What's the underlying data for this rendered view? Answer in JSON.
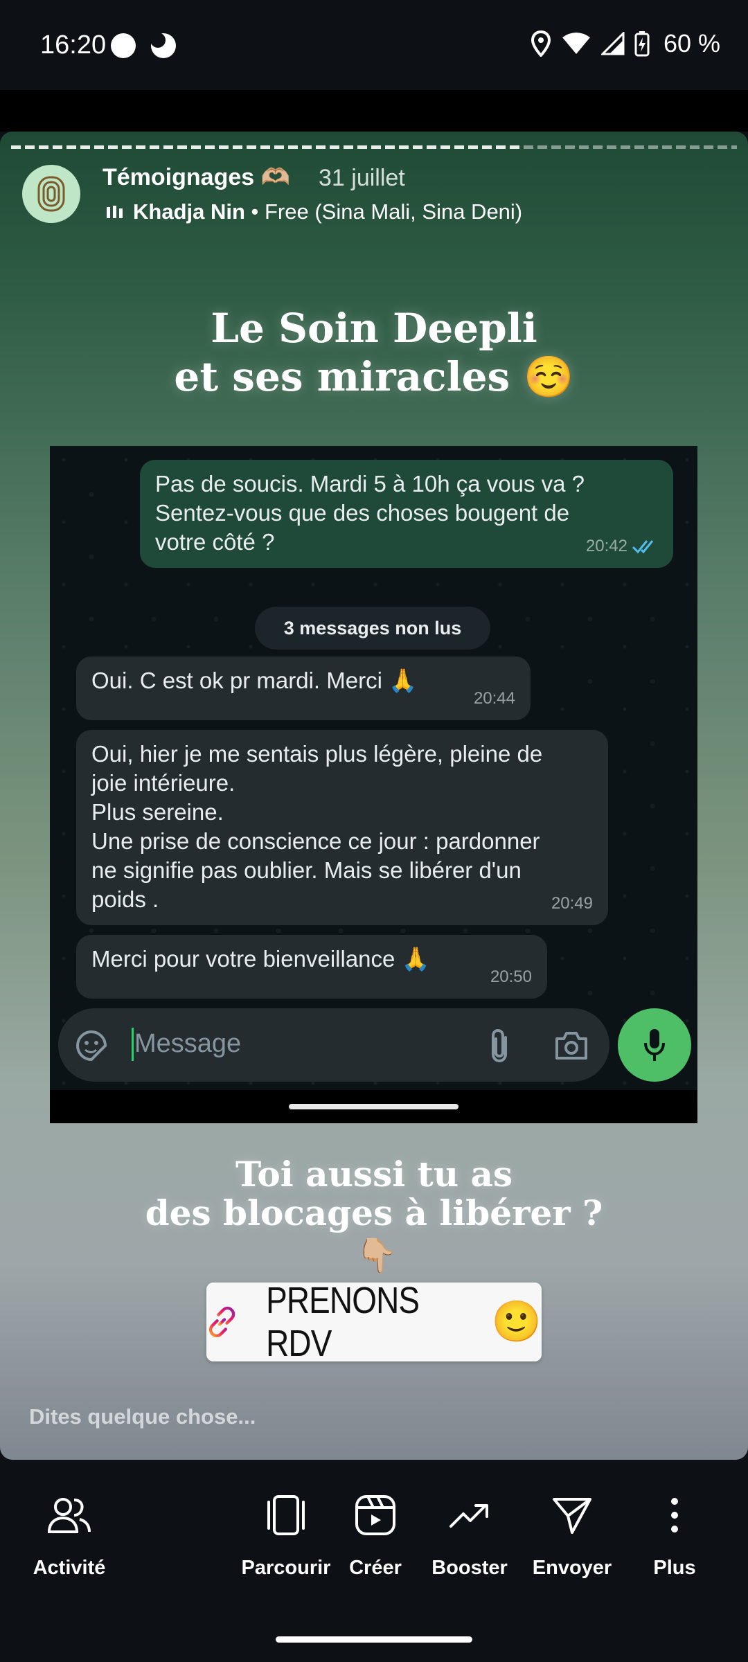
{
  "status_bar": {
    "time": "16:20",
    "battery": "60 %"
  },
  "story": {
    "username": "Témoignages",
    "username_emoji": "🫶🏼",
    "date": "31 juillet",
    "music_artist": "Khadja Nin",
    "music_title": "• Free (Sina Mali, Sina Deni)",
    "headline_line1": "Le Soin Deepli",
    "headline_line2": "et ses miracles ☺️",
    "cta_line1": "Toi aussi tu as",
    "cta_line2": "des blocages à libérer ?",
    "pointer_emoji": "👇🏼",
    "link_sticker_label": "PRENONS RDV",
    "link_sticker_emoji": "🙂",
    "reply_placeholder": "Dites quelque chose..."
  },
  "chat": {
    "outgoing": {
      "line1": "Pas de soucis. Mardi 5 à 10h ça vous va ?",
      "line2": "Sentez-vous que des choses bougent de",
      "line3": "votre côté ?",
      "time": "20:42"
    },
    "unread_label": "3 messages non lus",
    "incoming": [
      {
        "text": "Oui. C est ok pr mardi. Merci 🙏",
        "time": "20:44"
      },
      {
        "line1": "Oui, hier je me sentais plus légère,  pleine de",
        "line2": "joie intérieure.",
        "line3": "Plus sereine.",
        "line4": "Une prise de conscience ce jour :  pardonner",
        "line5": "ne signifie pas oublier. Mais se libérer d'un",
        "line6": "poids .",
        "time": "20:49"
      },
      {
        "text": "Merci pour votre bienveillance 🙏",
        "time": "20:50"
      }
    ],
    "input_placeholder": "Message"
  },
  "bottom_nav": {
    "activity": "Activité",
    "browse": "Parcourir",
    "create": "Créer",
    "boost": "Booster",
    "send": "Envoyer",
    "more": "Plus"
  },
  "colors": {
    "wa_outgoing": "#1f4a39",
    "wa_incoming": "#242c30",
    "mic_green": "#4fbf67"
  }
}
